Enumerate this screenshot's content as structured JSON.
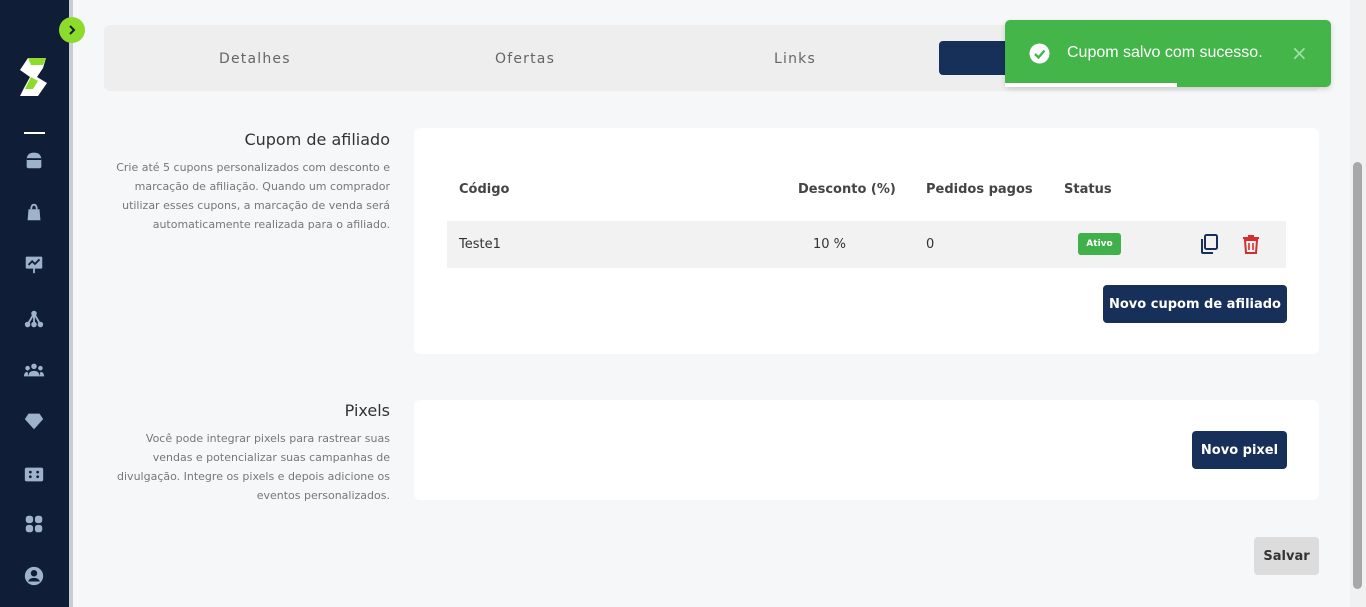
{
  "tabs": {
    "items": [
      {
        "label": "Detalhes"
      },
      {
        "label": "Ofertas"
      },
      {
        "label": "Links"
      }
    ]
  },
  "toast": {
    "message": "Cupom salvo com sucesso.",
    "close": "×",
    "color": "#43b549"
  },
  "affiliate_coupon": {
    "title": "Cupom de afiliado",
    "description": "Crie até 5 cupons personalizados com desconto e marcação de afiliação. Quando um comprador utilizar esses cupons, a marcação de venda será automaticamente realizada para o afiliado.",
    "columns": [
      "Código",
      "Desconto (%)",
      "Pedidos pagos",
      "Status"
    ],
    "rows": [
      {
        "code": "Teste1",
        "discount": "10 %",
        "paid_orders": "0",
        "status": "Ativo"
      }
    ],
    "new_button": "Novo cupom de afiliado"
  },
  "pixels": {
    "title": "Pixels",
    "description": "Você pode integrar pixels para rastrear suas vendas e potencializar suas campanhas de divulgação. Integre os pixels e depois adicione os eventos personalizados.",
    "new_button": "Novo pixel"
  },
  "save_button": "Salvar",
  "colors": {
    "sidebar": "#0f1e36",
    "accent": "#8ddc2c",
    "navy": "#16305a",
    "success": "#43b549",
    "danger": "#d32f2f"
  },
  "sidebar_icons": [
    "home-icon",
    "bag-icon",
    "presentation-chart-icon",
    "network-icon",
    "users-icon",
    "diamond-icon",
    "ticket-icon",
    "apps-grid-icon",
    "account-icon"
  ]
}
